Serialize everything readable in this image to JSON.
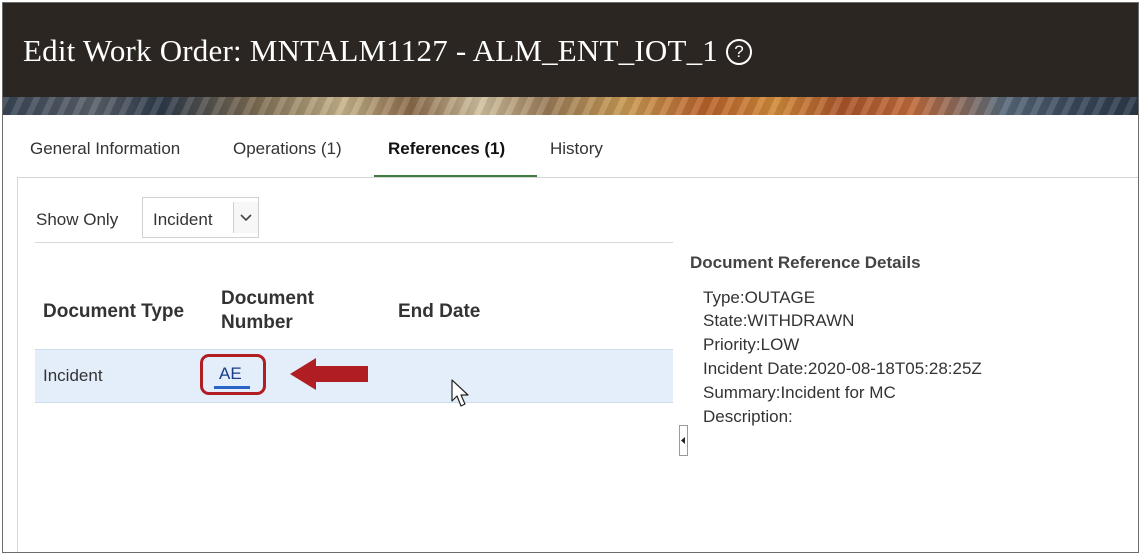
{
  "page": {
    "title": "Edit Work Order: MNTALM1127 - ALM_ENT_IOT_1",
    "help_icon": "question-circle-icon"
  },
  "tabs": [
    {
      "label": "General Information",
      "active": false
    },
    {
      "label": "Operations (1)",
      "active": false
    },
    {
      "label": "References (1)",
      "active": true
    },
    {
      "label": "History",
      "active": false
    }
  ],
  "filter": {
    "label": "Show Only",
    "value": "Incident"
  },
  "table": {
    "columns": {
      "document_type": "Document Type",
      "document_number_line1": "Document",
      "document_number_line2": "Number",
      "end_date": "End Date"
    },
    "rows": [
      {
        "document_type": "Incident",
        "document_number": "AE",
        "end_date": ""
      }
    ]
  },
  "details": {
    "title": "Document Reference Details",
    "lines": [
      "Type:OUTAGE",
      "State:WITHDRAWN",
      "Priority:LOW",
      "Incident Date:2020-08-18T05:28:25Z",
      "Summary:Incident for MC",
      "Description:"
    ]
  },
  "colors": {
    "accent_underline": "#3f7a45",
    "callout_red": "#b01e23",
    "selected_row": "#e3eefa",
    "titlebar": "#2b2621"
  }
}
